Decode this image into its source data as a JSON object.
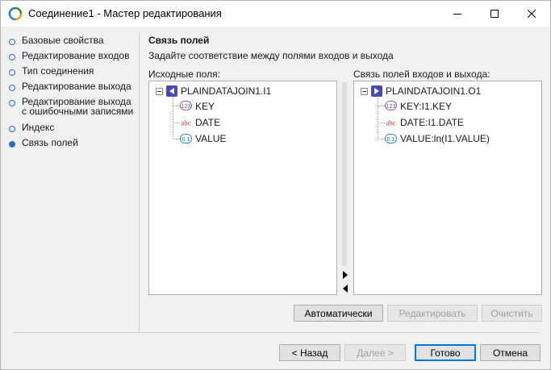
{
  "window": {
    "title": "Соединение1 - Мастер редактирования"
  },
  "nav": {
    "items": [
      {
        "label": "Базовые свойства",
        "active": false
      },
      {
        "label": "Редактирование входов",
        "active": false
      },
      {
        "label": "Тип соединения",
        "active": false
      },
      {
        "label": "Редактирование выхода",
        "active": false
      },
      {
        "label": "Редактирование выхода с ошибочными записями",
        "active": false
      },
      {
        "label": "Индекс",
        "active": false
      },
      {
        "label": "Связь полей",
        "active": true
      }
    ]
  },
  "main": {
    "title": "Связь полей",
    "subtitle": "Задайте соответствие между полями входов и выхода",
    "source_label": "Исходные поля:",
    "link_label": "Связь полей входов и выхода:"
  },
  "source_tree": {
    "root": "PLAINDATAJOIN1.I1",
    "fields": [
      {
        "label": "KEY",
        "icon": "integer-type-icon",
        "icon_text": "123"
      },
      {
        "label": "DATE",
        "icon": "string-type-icon",
        "icon_text": "abc"
      },
      {
        "label": "VALUE",
        "icon": "float-type-icon",
        "icon_text": "0.1"
      }
    ]
  },
  "link_tree": {
    "root": "PLAINDATAJOIN1.O1",
    "fields": [
      {
        "label": "KEY:I1.KEY",
        "icon": "integer-type-icon",
        "icon_text": "123"
      },
      {
        "label": "DATE:I1.DATE",
        "icon": "string-type-icon",
        "icon_text": "abc"
      },
      {
        "label": "VALUE:ln(I1.VALUE)",
        "icon": "float-type-icon",
        "icon_text": "0.1"
      }
    ]
  },
  "actions": {
    "auto": "Автоматически",
    "edit": "Редактировать",
    "clear": "Очистить"
  },
  "footer": {
    "back": "< Назад",
    "next": "Далее >",
    "done": "Готово",
    "cancel": "Отмена"
  },
  "colors": {
    "accent": "#0078d7",
    "nav_dot": "#2f6fb5",
    "input_arrow": "#4a4aa8"
  }
}
